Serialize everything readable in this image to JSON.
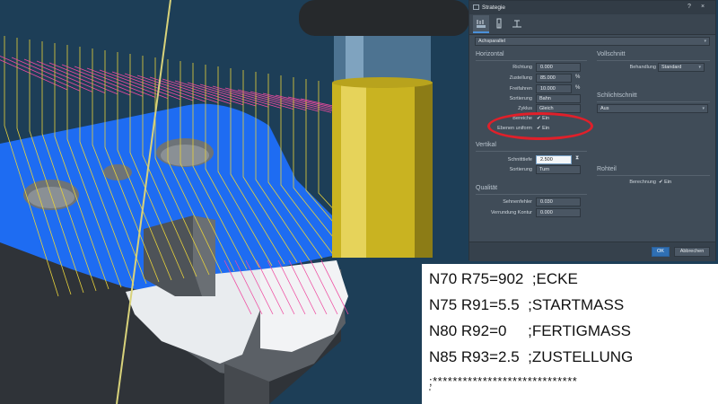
{
  "dialog": {
    "title": "Strategie",
    "help": "?",
    "close": "×",
    "strategy_select": "Achsparallel",
    "horizontal": {
      "heading": "Horizontal",
      "rows": [
        {
          "label": "Richtung",
          "value": "0.000",
          "unit": ""
        },
        {
          "label": "Zustellung",
          "value": "85.000",
          "unit": "%"
        },
        {
          "label": "Freifahren",
          "value": "10.000",
          "unit": "%"
        },
        {
          "label": "Sortierung",
          "value": "Bahn",
          "unit": ""
        },
        {
          "label": "Zyklus",
          "value": "Gleich",
          "unit": ""
        },
        {
          "label": "Bereiche",
          "value": "Ein",
          "unit": ""
        }
      ],
      "ebenen_label": "Ebenen uniform",
      "ebenen_value": "Ein"
    },
    "vertikal": {
      "heading": "Vertikal",
      "schnitttiefe_label": "Schnitttiefe",
      "schnitttiefe_value": "2.500",
      "sortierung_label": "Sortierung",
      "sortierung_value": "Turn"
    },
    "qualitaet": {
      "heading": "Qualität",
      "sehnenfehler_label": "Sehnenfehler",
      "sehnenfehler_value": "0.030",
      "verrundung_label": "Verrundung Kontur",
      "verrundung_value": "0.000"
    },
    "vollschnitt": {
      "heading": "Vollschnitt",
      "behandlung_label": "Behandlung",
      "behandlung_value": "Standard"
    },
    "schlichtschnitt": {
      "heading": "Schlichtschnitt",
      "value": "Aus"
    },
    "rohteil": {
      "heading": "Rohteil",
      "berechnung_label": "Berechnung",
      "berechnung_value": "Ein"
    },
    "ok_label": "OK",
    "cancel_label": "Abbrechen"
  },
  "code": {
    "lines": [
      "N70 R75=902  ;ECKE",
      "N75 R91=5.5  ;STARTMASS",
      "N80 R92=0     ;FERTIGMASS",
      "N85 R93=2.5  ;ZUSTELLUNG"
    ],
    "stars": ";*****************************",
    "tail": "'"
  },
  "colors": {
    "background": "#1e3f58",
    "surface": "#1f6ef0",
    "toolpath_yellow": "#e8d23a",
    "toolpath_pink": "#f04aa0",
    "highlight_ring": "#e0202a",
    "ok_button": "#2f6fb4"
  }
}
